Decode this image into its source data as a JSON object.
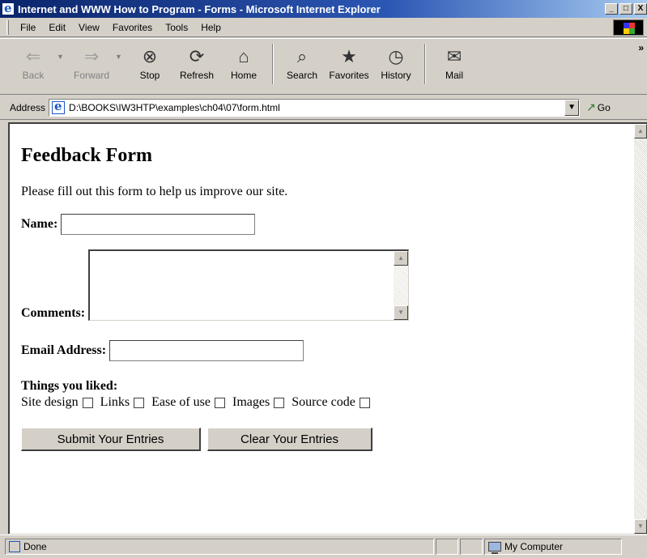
{
  "window": {
    "title": "Internet and WWW How to Program - Forms - Microsoft Internet Explorer",
    "minimize": "_",
    "maximize": "□",
    "close": "X"
  },
  "menu": [
    {
      "label": "File"
    },
    {
      "label": "Edit"
    },
    {
      "label": "View"
    },
    {
      "label": "Favorites"
    },
    {
      "label": "Tools"
    },
    {
      "label": "Help"
    }
  ],
  "toolbar": {
    "back": "Back",
    "forward": "Forward",
    "stop": "Stop",
    "refresh": "Refresh",
    "home": "Home",
    "search": "Search",
    "favorites": "Favorites",
    "history": "History",
    "mail": "Mail",
    "more": "»"
  },
  "address": {
    "label": "Address",
    "value": "D:\\BOOKS\\IW3HTP\\examples\\ch04\\07\\form.html",
    "go": "Go"
  },
  "page": {
    "heading": "Feedback Form",
    "intro": "Please fill out this form to help us improve our site.",
    "name_label": "Name:",
    "comments_label": "Comments:",
    "email_label": "Email Address:",
    "liked_label": "Things you liked:",
    "checkboxes": [
      "Site design",
      "Links",
      "Ease of use",
      "Images",
      "Source code"
    ],
    "submit": "Submit Your Entries",
    "clear": "Clear Your Entries"
  },
  "status": {
    "text": "Done",
    "zone": "My Computer"
  }
}
